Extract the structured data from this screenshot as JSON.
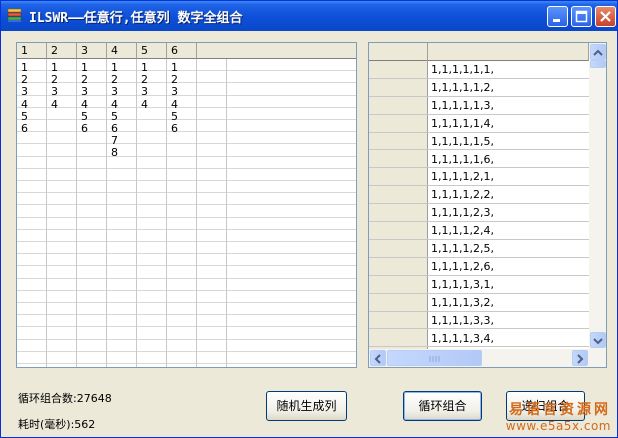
{
  "window": {
    "title": "ILSWR——任意行,任意列 数字全组合"
  },
  "left_grid": {
    "headers": [
      "1",
      "2",
      "3",
      "4",
      "5",
      "6"
    ],
    "columns": [
      [
        "1",
        "2",
        "3",
        "4",
        "5",
        "6"
      ],
      [
        "1",
        "2",
        "3",
        "4"
      ],
      [
        "1",
        "2",
        "3",
        "4",
        "5",
        "6"
      ],
      [
        "1",
        "2",
        "3",
        "4",
        "5",
        "6",
        "7",
        "8"
      ],
      [
        "1",
        "2",
        "3",
        "4"
      ],
      [
        "1",
        "2",
        "3",
        "4",
        "5",
        "6"
      ]
    ]
  },
  "right_grid": {
    "rows": [
      "1,1,1,1,1,1,",
      "1,1,1,1,1,2,",
      "1,1,1,1,1,3,",
      "1,1,1,1,1,4,",
      "1,1,1,1,1,5,",
      "1,1,1,1,1,6,",
      "1,1,1,1,2,1,",
      "1,1,1,1,2,2,",
      "1,1,1,1,2,3,",
      "1,1,1,1,2,4,",
      "1,1,1,1,2,5,",
      "1,1,1,1,2,6,",
      "1,1,1,1,3,1,",
      "1,1,1,1,3,2,",
      "1,1,1,1,3,3,",
      "1,1,1,1,3,4,"
    ]
  },
  "status": {
    "combo_count_label": "循环组合数:",
    "combo_count_value": "27648",
    "elapsed_label": "耗时(毫秒):",
    "elapsed_value": "562"
  },
  "buttons": {
    "random": "随机生成列",
    "loop": "循环组合",
    "recursive": "递归组合"
  },
  "watermark": {
    "line1": "易语言资源网",
    "line2": "www.e5a5x.com"
  },
  "colors": {
    "titlebar": "#0a48c8",
    "window_bg": "#ece9d8",
    "grid_border": "#7f9db9",
    "watermark": "#d36a1a"
  }
}
